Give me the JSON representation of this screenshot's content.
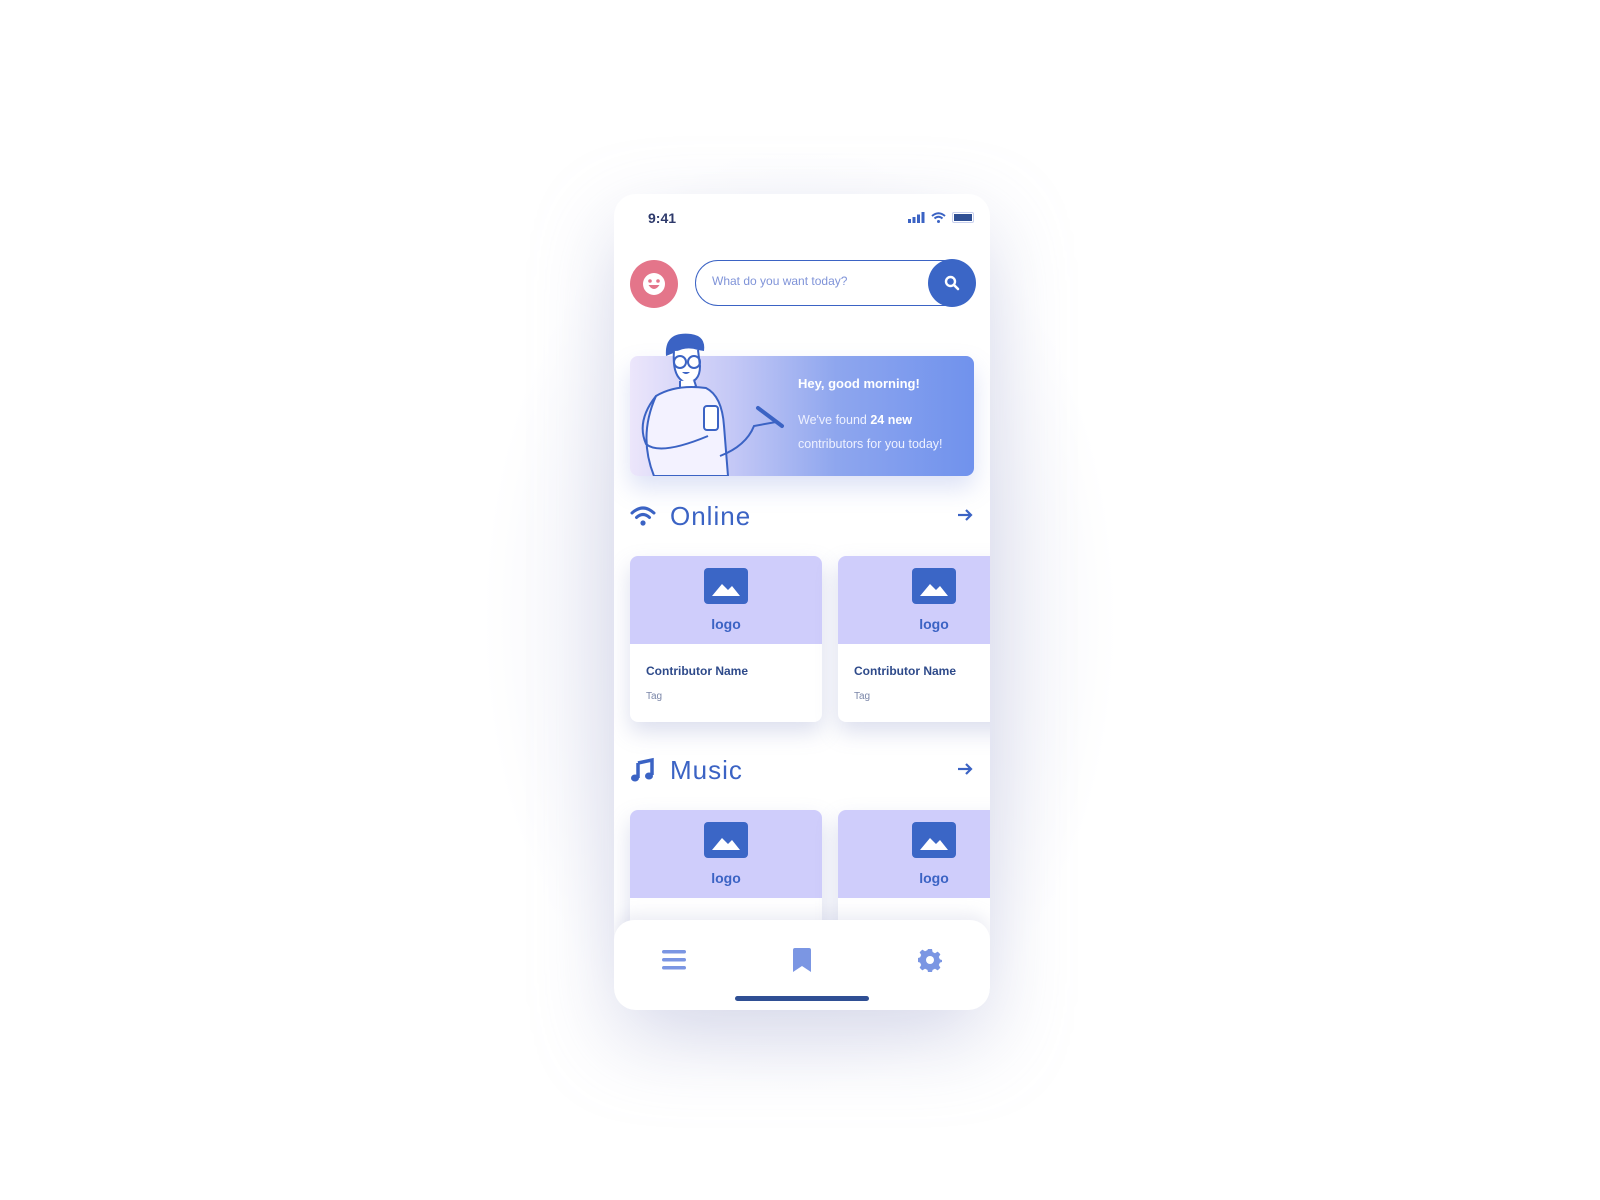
{
  "status_bar": {
    "time": "9:41",
    "icons": [
      "signal-icon",
      "wifi-icon",
      "battery-icon"
    ]
  },
  "header": {
    "avatar_icon": "smiley-face-icon",
    "search": {
      "placeholder": "What do you want today?",
      "value": "",
      "button_icon": "search-icon"
    }
  },
  "banner": {
    "greeting": "Hey, good morning!",
    "text_prefix": "We've found ",
    "highlight": "24 new",
    "text_suffix": " contributors for you today!",
    "illustration": "man-with-phone-and-pen"
  },
  "sections": [
    {
      "title": "Online",
      "icon": "wifi-icon",
      "arrow_icon": "arrow-right-icon",
      "cards": [
        {
          "logo": "logo",
          "name": "Contributor Name",
          "tag": "Tag"
        },
        {
          "logo": "logo",
          "name": "Contributor Name",
          "tag": "Tag"
        }
      ]
    },
    {
      "title": "Music",
      "icon": "music-note-icon",
      "arrow_icon": "arrow-right-icon",
      "cards": [
        {
          "logo": "logo",
          "name": "",
          "tag": ""
        },
        {
          "logo": "logo",
          "name": "",
          "tag": ""
        }
      ]
    }
  ],
  "bottom_nav": [
    {
      "icon": "menu-icon",
      "active": false
    },
    {
      "icon": "bookmark-icon",
      "active": true
    },
    {
      "icon": "gear-icon",
      "active": false
    }
  ],
  "colors": {
    "primary": "#3b63c4",
    "avatar": "#e4758a",
    "card_top": "#cfcdfb",
    "nav_icon": "#7b96e3"
  }
}
